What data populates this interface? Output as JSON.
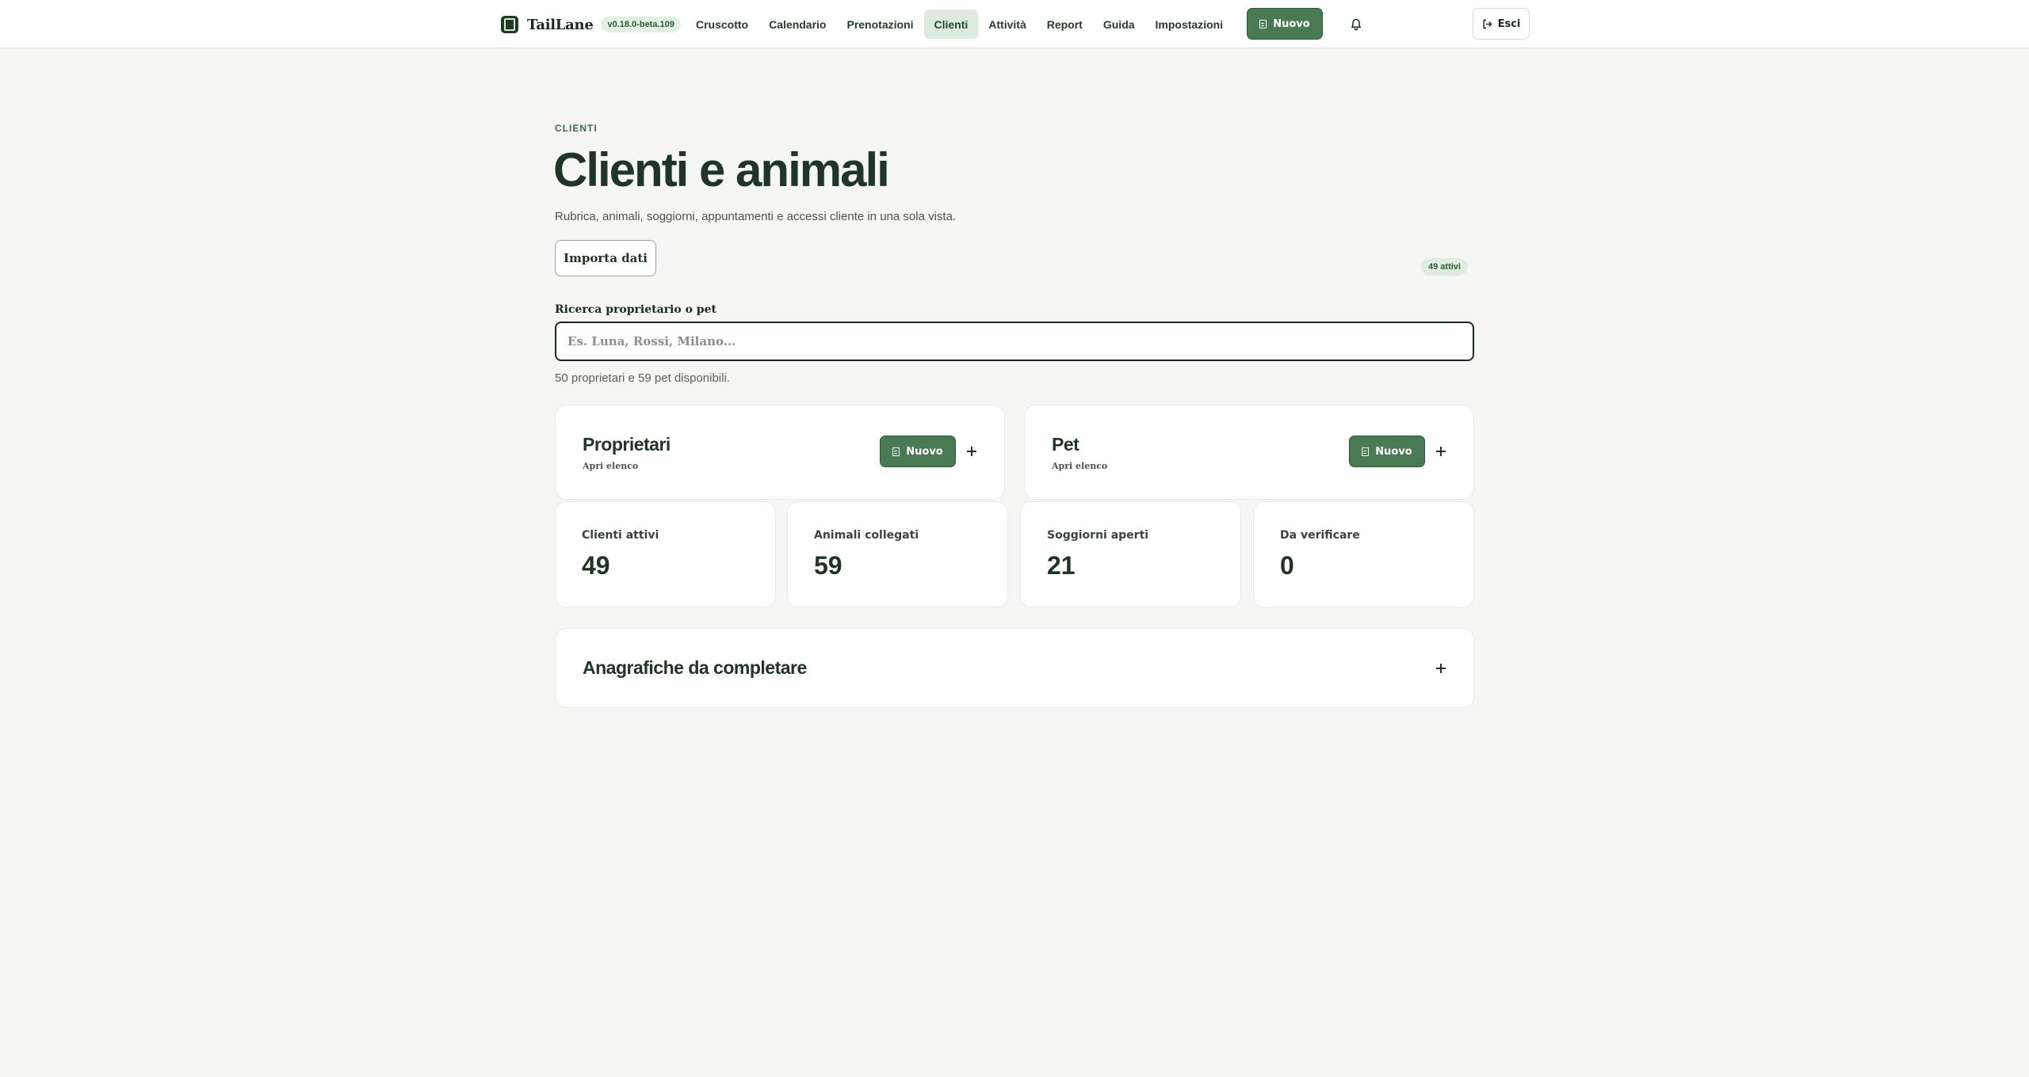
{
  "app": {
    "name": "TailLane",
    "version": "v0.18.0-beta.109"
  },
  "nav": {
    "items": [
      {
        "label": "Cruscotto",
        "active": false
      },
      {
        "label": "Calendario",
        "active": false
      },
      {
        "label": "Prenotazioni",
        "active": false
      },
      {
        "label": "Clienti",
        "active": true
      },
      {
        "label": "Attività",
        "active": false
      },
      {
        "label": "Report",
        "active": false
      },
      {
        "label": "Guida",
        "active": false
      },
      {
        "label": "Impostazioni",
        "active": false
      }
    ],
    "new_label": "Nuovo",
    "logout_label": "Esci"
  },
  "page": {
    "eyebrow": "CLIENTI",
    "title": "Clienti e animali",
    "subtitle": "Rubrica, animali, soggiorni, appuntamenti e accessi cliente in una sola vista.",
    "import_label": "Importa dati",
    "active_badge": "49 attivi"
  },
  "search": {
    "label": "Ricerca proprietario o pet",
    "placeholder": "Es. Luna, Rossi, Milano...",
    "value": "",
    "hint": "50 proprietari e 59 pet disponibili."
  },
  "cards": {
    "owners": {
      "title": "Proprietari",
      "sub": "Apri elenco",
      "new_label": "Nuovo"
    },
    "pets": {
      "title": "Pet",
      "sub": "Apri elenco",
      "new_label": "Nuovo"
    }
  },
  "stats": [
    {
      "label": "Clienti attivi",
      "value": "49"
    },
    {
      "label": "Animali collegati",
      "value": "59"
    },
    {
      "label": "Soggiorni aperti",
      "value": "21"
    },
    {
      "label": "Da verificare",
      "value": "0"
    }
  ],
  "incomplete": {
    "title": "Anagrafiche da completare"
  },
  "colors": {
    "accent": "#4a7a53",
    "active_nav_bg": "#dcebdc",
    "background": "#f6f6f4"
  }
}
